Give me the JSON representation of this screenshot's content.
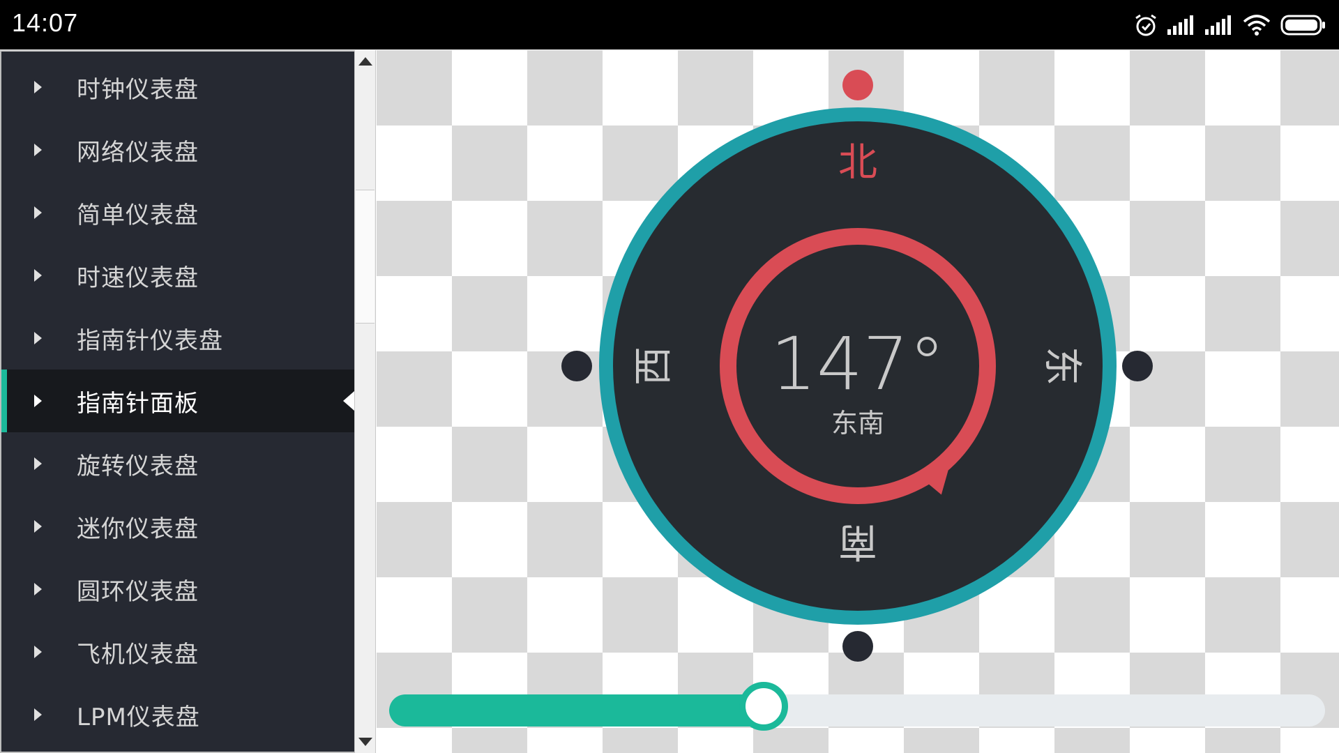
{
  "status_bar": {
    "time": "14:07",
    "icons": [
      "alarm-icon",
      "signal-icon",
      "signal-icon",
      "wifi-icon",
      "battery-icon"
    ]
  },
  "sidebar": {
    "items": [
      {
        "label": "时钟仪表盘",
        "active": false
      },
      {
        "label": "网络仪表盘",
        "active": false
      },
      {
        "label": "简单仪表盘",
        "active": false
      },
      {
        "label": "时速仪表盘",
        "active": false
      },
      {
        "label": "指南针仪表盘",
        "active": false
      },
      {
        "label": "指南针面板",
        "active": true
      },
      {
        "label": "旋转仪表盘",
        "active": false
      },
      {
        "label": "迷你仪表盘",
        "active": false
      },
      {
        "label": "圆环仪表盘",
        "active": false
      },
      {
        "label": "飞机仪表盘",
        "active": false
      },
      {
        "label": "LPM仪表盘",
        "active": false
      }
    ]
  },
  "compass": {
    "degree_text": "147°",
    "degree_value": 147,
    "direction_text": "东南",
    "north": "北",
    "south": "南",
    "east": "东",
    "west": "西",
    "colors": {
      "ring": "#1f9fa8",
      "face": "#272b30",
      "pointer": "#d94c55",
      "north_text": "#d94c55",
      "text": "#c9c9c9",
      "dot": "#262932"
    }
  },
  "slider": {
    "value": 0.4,
    "colors": {
      "fill": "#1bb99a",
      "track": "#e8ecef"
    }
  }
}
